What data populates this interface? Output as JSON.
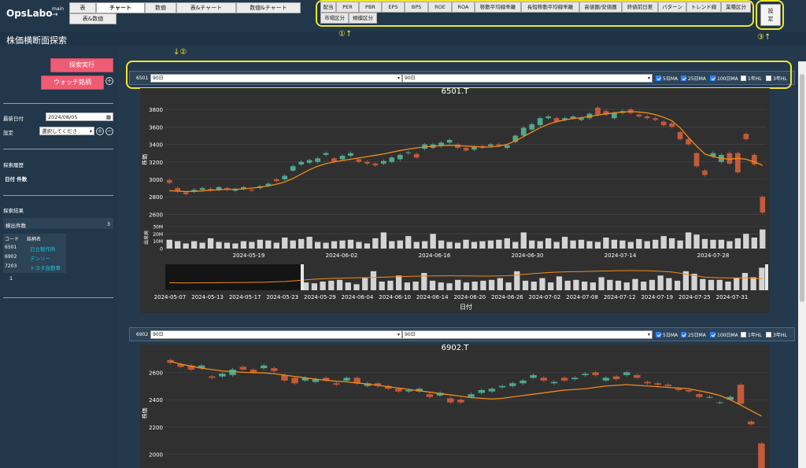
{
  "header": {
    "logo": "OpsLabo",
    "logo_sub": "main",
    "logo_arrow": "→",
    "tabs": [
      "表",
      "チャート",
      "数値",
      "表&チャート",
      "数値&チャート",
      "表&数値"
    ],
    "metrics": [
      "配当",
      "PER",
      "PBR",
      "EPS",
      "BPS",
      "ROE",
      "ROA",
      "移動平均線乖離",
      "長短移動平均線乖離",
      "高値圏/安値圏",
      "終値前日差",
      "パターン",
      "トレンド線",
      "業種区分",
      "市場区分",
      "規模区分"
    ],
    "settings_label_1": "設",
    "settings_label_2": "定",
    "anno_1": "①↑",
    "anno_2": "↓②",
    "anno_3": "③↑"
  },
  "page_title": "株価横断面探索",
  "sidebar": {
    "search_button": "探索実行",
    "watch_button": "ウォッチ銘柄",
    "plus": "+",
    "minus": "−",
    "latest_date_label": "最新日付",
    "latest_date_value": "2024/08/05",
    "calendar_icon": "▦",
    "setting_label": "設定",
    "setting_value": "選択してくださ",
    "setting_arrow": "▾",
    "history_label": "探索履歴",
    "history_cols": "日付 件数",
    "result_label": "探索結果",
    "count_label": "検出件数",
    "count_value": "3",
    "table_code_header": "コード",
    "table_name_header": "銘柄名",
    "stocks": [
      {
        "code": "6501",
        "name": "日立製作所"
      },
      {
        "code": "6902",
        "name": "デンソー"
      },
      {
        "code": "7203",
        "name": "トヨタ自動車"
      }
    ],
    "page": "1"
  },
  "panels": [
    {
      "code": "6501",
      "select1": "90日",
      "select2": "90日",
      "select_arrow": "▾",
      "options": [
        "5日MA",
        "25日MA",
        "100日MA",
        "1年HL",
        "3年HL"
      ],
      "checked": [
        true,
        true,
        true,
        false,
        false
      ],
      "title": "6501.T"
    },
    {
      "code": "6902",
      "select1": "90日",
      "select2": "90日",
      "select_arrow": "▾",
      "options": [
        "5日MA",
        "25日MA",
        "100日MA",
        "1年HL",
        "3年HL"
      ],
      "checked": [
        true,
        true,
        true,
        false,
        false
      ],
      "title": "6902.T"
    }
  ],
  "chart_data": [
    {
      "type": "candlestick",
      "title": "6501.T",
      "ylabel": "株価",
      "volume_label": "出来高",
      "xlabel": "日付",
      "ylim": [
        2550,
        3900
      ],
      "yticks": [
        2600,
        2800,
        3000,
        3200,
        3400,
        3600,
        3800
      ],
      "x_ticks": [
        "2024-05-19",
        "2024-06-02",
        "2024-06-16",
        "2024-06-30",
        "2024-07-14",
        "2024-07-28"
      ],
      "volume_ticks": [
        "0",
        "10M",
        "20M",
        "30M"
      ],
      "nav_x_ticks": [
        "2024-05-07",
        "2024-05-13",
        "2024-05-17",
        "2024-05-23",
        "2024-05-29",
        "2024-06-04",
        "2024-06-10",
        "2024-06-14",
        "2024-06-20",
        "2024-06-26",
        "2024-07-02",
        "2024-07-08",
        "2024-07-12",
        "2024-07-19",
        "2024-07-25",
        "2024-07-31"
      ],
      "candles": [
        [
          2990,
          2960
        ],
        [
          2900,
          2860
        ],
        [
          2850,
          2830
        ],
        [
          2860,
          2880
        ],
        [
          2880,
          2900
        ],
        [
          2890,
          2870
        ],
        [
          2880,
          2910
        ],
        [
          2900,
          2880
        ],
        [
          2870,
          2890
        ],
        [
          2890,
          2910
        ],
        [
          2880,
          2870
        ],
        [
          2900,
          2920
        ],
        [
          2930,
          2950
        ],
        [
          3000,
          2980
        ],
        [
          3000,
          3040
        ],
        [
          3100,
          3150
        ],
        [
          3170,
          3200
        ],
        [
          3190,
          3220
        ],
        [
          3200,
          3240
        ],
        [
          3280,
          3300
        ],
        [
          3240,
          3200
        ],
        [
          3230,
          3270
        ],
        [
          3270,
          3300
        ],
        [
          3230,
          3200
        ],
        [
          3200,
          3180
        ],
        [
          3180,
          3160
        ],
        [
          3180,
          3210
        ],
        [
          3200,
          3250
        ],
        [
          3230,
          3280
        ],
        [
          3300,
          3310
        ],
        [
          3290,
          3250
        ],
        [
          3350,
          3400
        ],
        [
          3360,
          3400
        ],
        [
          3380,
          3420
        ],
        [
          3420,
          3450
        ],
        [
          3400,
          3360
        ],
        [
          3360,
          3330
        ],
        [
          3340,
          3370
        ],
        [
          3380,
          3360
        ],
        [
          3380,
          3400
        ],
        [
          3400,
          3380
        ],
        [
          3360,
          3390
        ],
        [
          3430,
          3500
        ],
        [
          3500,
          3590
        ],
        [
          3570,
          3630
        ],
        [
          3620,
          3700
        ],
        [
          3700,
          3720
        ],
        [
          3700,
          3660
        ],
        [
          3680,
          3700
        ],
        [
          3700,
          3720
        ],
        [
          3680,
          3700
        ],
        [
          3700,
          3750
        ],
        [
          3820,
          3740
        ],
        [
          3780,
          3740
        ],
        [
          3700,
          3760
        ],
        [
          3760,
          3780
        ],
        [
          3800,
          3760
        ],
        [
          3740,
          3720
        ],
        [
          3720,
          3700
        ],
        [
          3700,
          3680
        ],
        [
          3660,
          3620
        ],
        [
          3640,
          3600
        ],
        [
          3540,
          3460
        ],
        [
          3460,
          3400
        ],
        [
          3300,
          3150
        ],
        [
          3100,
          3050
        ],
        [
          3260,
          3300
        ],
        [
          3200,
          3280
        ],
        [
          3300,
          3180
        ],
        [
          3300,
          3080
        ],
        [
          3520,
          3460
        ],
        [
          3280,
          3170
        ],
        [
          2800,
          2620
        ]
      ],
      "ma25": [
        2870,
        2865,
        2860,
        2862,
        2868,
        2875,
        2880,
        2885,
        2885,
        2890,
        2900,
        2910,
        2925,
        2945,
        2970,
        3010,
        3060,
        3110,
        3150,
        3180,
        3200,
        3215,
        3230,
        3245,
        3260,
        3275,
        3290,
        3310,
        3330,
        3345,
        3360,
        3370,
        3380,
        3385,
        3390,
        3385,
        3380,
        3375,
        3370,
        3370,
        3380,
        3400,
        3440,
        3490,
        3540,
        3590,
        3630,
        3660,
        3680,
        3695,
        3705,
        3720,
        3735,
        3750,
        3760,
        3770,
        3775,
        3770,
        3760,
        3740,
        3710,
        3670,
        3590,
        3480,
        3380,
        3290,
        3260,
        3240,
        3230,
        3240,
        3230,
        3200,
        3160
      ],
      "volume": [
        12,
        10,
        7,
        10,
        8,
        14,
        9,
        8,
        7,
        10,
        9,
        12,
        11,
        8,
        15,
        11,
        13,
        16,
        9,
        8,
        10,
        11,
        12,
        9,
        7,
        14,
        22,
        10,
        11,
        17,
        9,
        10,
        20,
        11,
        9,
        8,
        12,
        9,
        10,
        11,
        12,
        14,
        9,
        22,
        11,
        10,
        14,
        9,
        16,
        11,
        12,
        10,
        9,
        15,
        12,
        11,
        9,
        13,
        10,
        12,
        17,
        14,
        11,
        22,
        19,
        13,
        12,
        12,
        10,
        14,
        20,
        15,
        26
      ]
    },
    {
      "type": "candlestick",
      "title": "6902.T",
      "ylabel": "株価",
      "ylim": [
        1900,
        2700
      ],
      "yticks": [
        2000,
        2200,
        2400,
        2600
      ],
      "candles": [
        [
          2690,
          2670
        ],
        [
          2660,
          2640
        ],
        [
          2650,
          2620
        ],
        [
          2630,
          2650
        ],
        [
          2570,
          2560
        ],
        [
          2570,
          2590
        ],
        [
          2580,
          2620
        ],
        [
          2640,
          2620
        ],
        [
          2620,
          2600
        ],
        [
          2630,
          2650
        ],
        [
          2630,
          2610
        ],
        [
          2580,
          2540
        ],
        [
          2560,
          2520
        ],
        [
          2540,
          2560
        ],
        [
          2530,
          2550
        ],
        [
          2560,
          2540
        ],
        [
          2520,
          2510
        ],
        [
          2540,
          2560
        ],
        [
          2560,
          2520
        ],
        [
          2500,
          2520
        ],
        [
          2520,
          2500
        ],
        [
          2500,
          2480
        ],
        [
          2480,
          2460
        ],
        [
          2460,
          2470
        ],
        [
          2460,
          2480
        ],
        [
          2440,
          2420
        ],
        [
          2430,
          2450
        ],
        [
          2410,
          2380
        ],
        [
          2400,
          2380
        ],
        [
          2420,
          2440
        ],
        [
          2450,
          2470
        ],
        [
          2460,
          2480
        ],
        [
          2490,
          2500
        ],
        [
          2500,
          2520
        ],
        [
          2520,
          2540
        ],
        [
          2560,
          2580
        ],
        [
          2560,
          2540
        ],
        [
          2520,
          2530
        ],
        [
          2560,
          2540
        ],
        [
          2550,
          2560
        ],
        [
          2580,
          2590
        ],
        [
          2600,
          2580
        ],
        [
          2540,
          2560
        ],
        [
          2570,
          2550
        ],
        [
          2580,
          2600
        ],
        [
          2580,
          2560
        ],
        [
          2530,
          2520
        ],
        [
          2520,
          2510
        ],
        [
          2510,
          2500
        ],
        [
          2480,
          2470
        ],
        [
          2470,
          2460
        ],
        [
          2440,
          2420
        ],
        [
          2420,
          2420
        ],
        [
          2380,
          2380
        ],
        [
          2400,
          2420
        ],
        [
          2510,
          2370
        ],
        [
          2240,
          2220
        ],
        [
          2080,
          1880
        ]
      ],
      "ma25": [
        2680,
        2660,
        2645,
        2630,
        2620,
        2610,
        2605,
        2600,
        2598,
        2596,
        2590,
        2580,
        2570,
        2560,
        2550,
        2542,
        2535,
        2530,
        2522,
        2515,
        2505,
        2495,
        2485,
        2475,
        2465,
        2455,
        2445,
        2435,
        2425,
        2415,
        2410,
        2405,
        2410,
        2420,
        2430,
        2440,
        2450,
        2460,
        2470,
        2475,
        2480,
        2490,
        2500,
        2505,
        2510,
        2505,
        2500,
        2495,
        2490,
        2485,
        2480,
        2465,
        2450,
        2430,
        2400,
        2360,
        2320,
        2280
      ]
    }
  ]
}
